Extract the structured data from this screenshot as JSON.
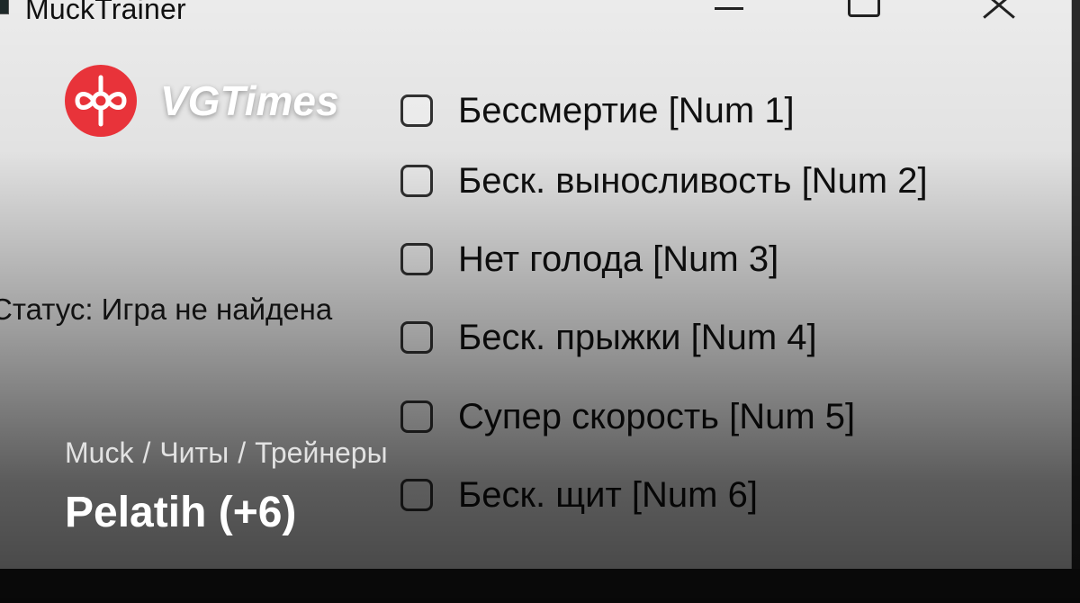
{
  "window": {
    "title": "MuckTrainer",
    "controls": {
      "minimize": "minimize-icon",
      "maximize": "maximize-icon",
      "close": "close-icon"
    }
  },
  "status": {
    "text": "Статус: Игра не найдена"
  },
  "options": [
    {
      "label": "Бессмертие [Num 1]",
      "checked": false
    },
    {
      "label": "Беск. выносливость [Num 2]",
      "checked": false
    },
    {
      "label": "Нет голода [Num 3]",
      "checked": false
    },
    {
      "label": "Беск. прыжки [Num 4]",
      "checked": false
    },
    {
      "label": "Супер скорость [Num 5]",
      "checked": false
    },
    {
      "label": "Беск. щит [Num 6]",
      "checked": false
    }
  ],
  "overlay": {
    "logo": {
      "text": "VGTimes",
      "icon": "vgtimes-logo-icon",
      "color": "#e8333a"
    },
    "breadcrumb": [
      "Muck",
      "/",
      "Читы",
      "/",
      "Трейнеры"
    ],
    "headline": "Pelatih (+6)"
  }
}
